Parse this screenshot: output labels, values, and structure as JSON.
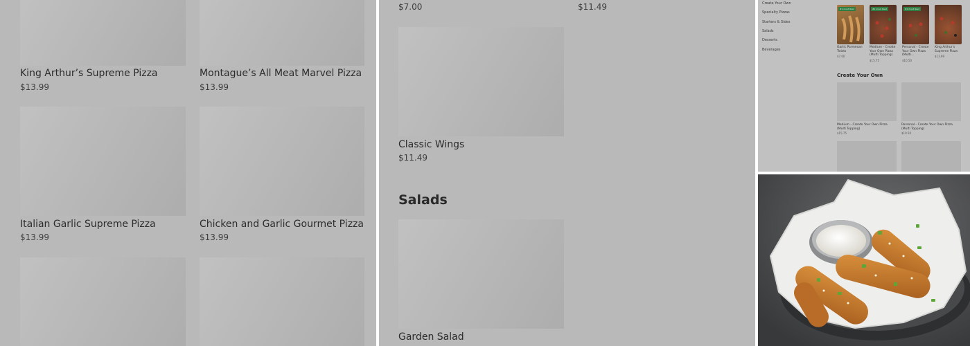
{
  "left_panel": {
    "items": [
      {
        "name": "King Arthur’s Supreme Pizza",
        "price": "$13.99"
      },
      {
        "name": "Montague’s All Meat Marvel Pizza",
        "price": "$13.99"
      },
      {
        "name": "Italian Garlic Supreme Pizza",
        "price": "$13.99"
      },
      {
        "name": "Chicken and Garlic Gourmet Pizza",
        "price": "$13.99"
      }
    ]
  },
  "middle_panel": {
    "top_prices": [
      "$7.00",
      "$11.49"
    ],
    "items": [
      {
        "name": "Classic Wings",
        "price": "$11.49"
      }
    ],
    "sections": [
      {
        "title": "Salads",
        "items": [
          {
            "name": "Garden Salad"
          }
        ]
      }
    ]
  },
  "right_top_panel": {
    "nav": [
      "Create Your Own",
      "Specialty Pizzas",
      "Starters & Sides",
      "Salads",
      "Desserts",
      "Beverages"
    ],
    "featured_tag": "#1 most liked",
    "featured": [
      {
        "name": "Garlic Parmesan Twists",
        "price": "$7.00"
      },
      {
        "name": "Medium - Create Your Own Pizza (Multi Topping)",
        "price": "$15.75"
      },
      {
        "name": "Personal - Create Your Own Pizza (Multi...",
        "price": "$10.50"
      },
      {
        "name": "King Arthur's Supreme Pizza",
        "price": "$13.99"
      }
    ],
    "section_title": "Create Your Own",
    "section_items": [
      {
        "name": "Medium - Create Your Own Pizza (Multi Topping)",
        "price": "$15.75"
      },
      {
        "name": "Personal - Create Your Own Pizza (Multi Topping)",
        "price": "$10.50"
      }
    ]
  },
  "colors": {
    "overlay_gray": "#b9b9b9",
    "thumb_gray": "#b6b6b6",
    "tag_green": "#2f7d43",
    "photo_background": "#4a4b4d"
  }
}
